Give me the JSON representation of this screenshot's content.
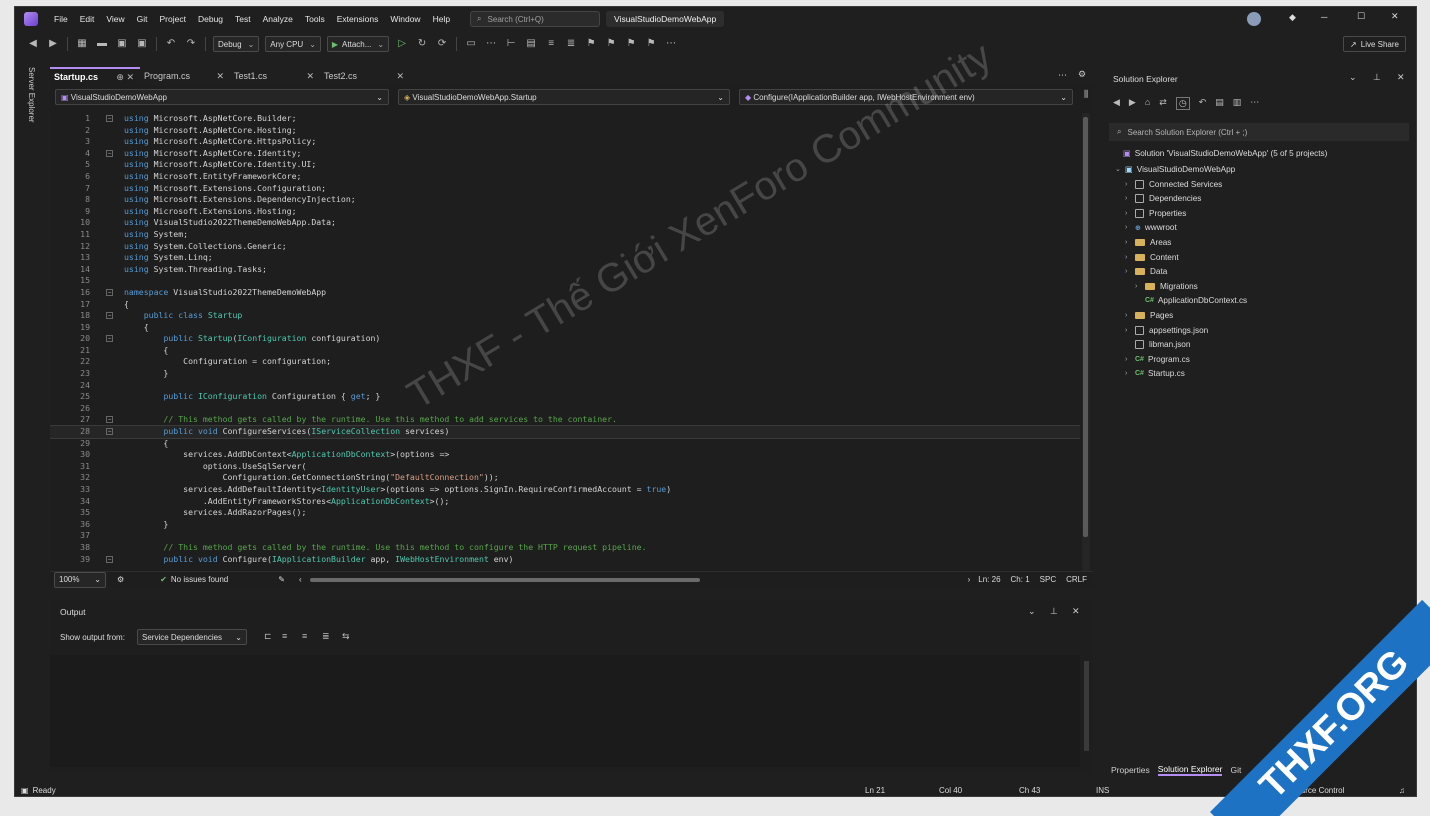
{
  "menubar": {
    "items": [
      "File",
      "Edit",
      "View",
      "Git",
      "Project",
      "Debug",
      "Test",
      "Analyze",
      "Tools",
      "Extensions",
      "Window",
      "Help"
    ],
    "search_placeholder": "Search (Ctrl+Q)",
    "project_title": "VisualStudioDemoWebApp"
  },
  "toolbar": {
    "config": "Debug",
    "platform": "Any CPU",
    "attach": "Attach...",
    "live_share": "Live Share"
  },
  "side_strip": {
    "label": "Server Explorer"
  },
  "editor": {
    "tabs": [
      {
        "label": "Startup.cs",
        "active": true
      },
      {
        "label": "Program.cs",
        "active": false
      },
      {
        "label": "Test1.cs",
        "active": false
      },
      {
        "label": "Test2.cs",
        "active": false
      }
    ],
    "nav": {
      "project": "VisualStudioDemoWebApp",
      "class": "VisualStudioDemoWebApp.Startup",
      "member": "Configure(IApplicationBuilder app, IWebHostEnvironment env)"
    },
    "lines": [
      "using Microsoft.AspNetCore.Builder;",
      "using Microsoft.AspNetCore.Hosting;",
      "using Microsoft.AspNetCore.HttpsPolicy;",
      "using Microsoft.AspNetCore.Identity;",
      "using Microsoft.AspNetCore.Identity.UI;",
      "using Microsoft.EntityFrameworkCore;",
      "using Microsoft.Extensions.Configuration;",
      "using Microsoft.Extensions.DependencyInjection;",
      "using Microsoft.Extensions.Hosting;",
      "using VisualStudio2022ThemeDemoWebApp.Data;",
      "using System;",
      "using System.Collections.Generic;",
      "using System.Linq;",
      "using System.Threading.Tasks;",
      "",
      "namespace VisualStudio2022ThemeDemoWebApp",
      "{",
      "    public class Startup",
      "    {",
      "        public Startup(IConfiguration configuration)",
      "        {",
      "            Configuration = configuration;",
      "        }",
      "",
      "        public IConfiguration Configuration { get; }",
      "",
      "        // This method gets called by the runtime. Use this method to add services to the container.",
      "        public void ConfigureServices(IServiceCollection services)",
      "        {",
      "            services.AddDbContext<ApplicationDbContext>(options =>",
      "                options.UseSqlServer(",
      "                    Configuration.GetConnectionString(\"DefaultConnection\"));",
      "            services.AddDefaultIdentity<IdentityUser>(options => options.SignIn.RequireConfirmedAccount = true)",
      "                .AddEntityFrameworkStores<ApplicationDbContext>();",
      "            services.AddRazorPages();",
      "        }",
      "",
      "        // This method gets called by the runtime. Use this method to configure the HTTP request pipeline.",
      "        public void Configure(IApplicationBuilder app, IWebHostEnvironment env)"
    ],
    "zoom": "100%",
    "issues": "No issues found",
    "ln": "Ln: 26",
    "ch": "Ch: 1",
    "spc": "SPC",
    "crlf": "CRLF"
  },
  "output": {
    "title": "Output",
    "show_from_label": "Show output from:",
    "source": "Service Dependencies"
  },
  "solution_explorer": {
    "title": "Solution Explorer",
    "search_placeholder": "Search Solution Explorer (Ctrl + ;)",
    "solution": "Solution 'VisualStudioDemoWebApp' (5 of 5 projects)",
    "project": "VisualStudioDemoWebApp",
    "items": [
      {
        "label": "Connected Services",
        "icon": "box",
        "depth": 1
      },
      {
        "label": "Dependencies",
        "icon": "box",
        "depth": 1
      },
      {
        "label": "Properties",
        "icon": "box",
        "depth": 1
      },
      {
        "label": "wwwroot",
        "icon": "globe",
        "depth": 1
      },
      {
        "label": "Areas",
        "icon": "folder",
        "depth": 1
      },
      {
        "label": "Content",
        "icon": "folder",
        "depth": 1
      },
      {
        "label": "Data",
        "icon": "folder",
        "depth": 1
      },
      {
        "label": "Migrations",
        "icon": "folder",
        "depth": 2
      },
      {
        "label": "ApplicationDbContext.cs",
        "icon": "cs",
        "depth": 2
      },
      {
        "label": "Pages",
        "icon": "folder",
        "depth": 1
      },
      {
        "label": "appsettings.json",
        "icon": "box",
        "depth": 1
      },
      {
        "label": "libman.json",
        "icon": "box",
        "depth": 1
      },
      {
        "label": "Program.cs",
        "icon": "cs",
        "depth": 1
      },
      {
        "label": "Startup.cs",
        "icon": "cs",
        "depth": 1
      }
    ],
    "bottom_tabs": [
      "Properties",
      "Solution Explorer",
      "Git"
    ]
  },
  "statusbar": {
    "ready": "Ready",
    "ln": "Ln 21",
    "col": "Col 40",
    "ch": "Ch 43",
    "ins": "INS",
    "source_control": "Source Control"
  },
  "watermark": {
    "text": "THXF - Thế Giới XenForo Community",
    "badge": "THXF.ORG"
  }
}
